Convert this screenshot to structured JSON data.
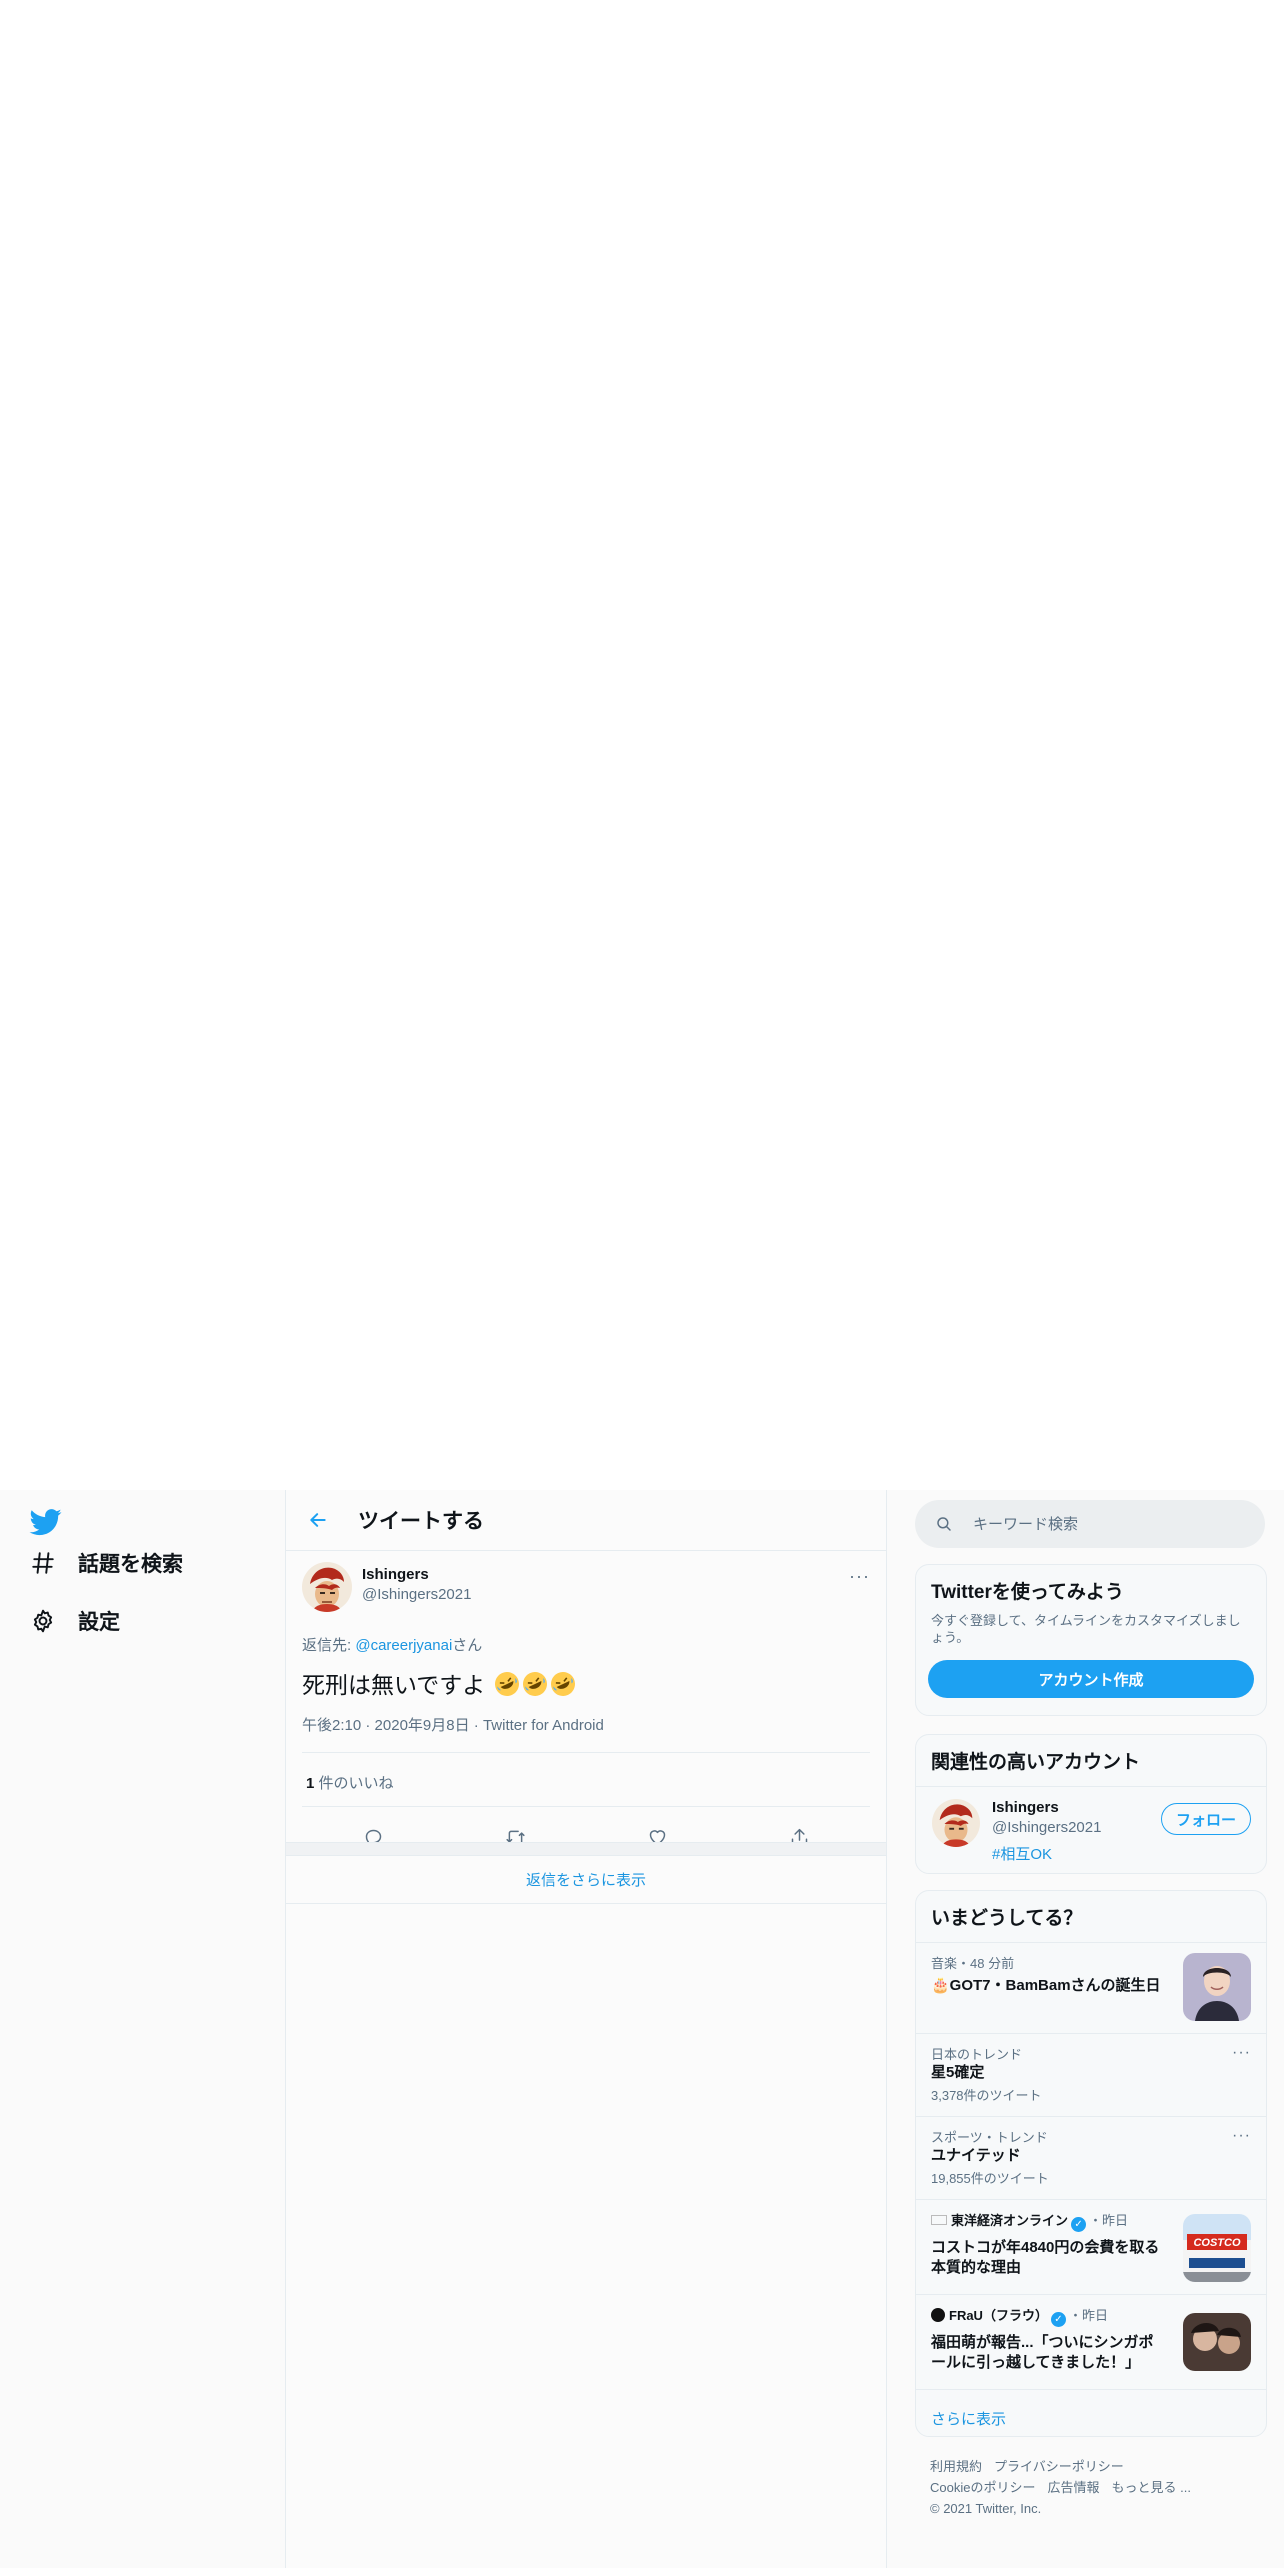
{
  "nav": {
    "explore_label": "話題を検索",
    "settings_label": "設定"
  },
  "header": {
    "title": "ツイートする"
  },
  "tweet": {
    "author_name": "Ishingers",
    "author_handle": "@Ishingers2021",
    "more_label": "···",
    "reply_prefix": "返信先: ",
    "reply_to": "@careerjyanai",
    "reply_suffix": "さん",
    "text": "死刑は無いですよ",
    "time": "午後2:10",
    "date": "2020年9月8日",
    "source": "Twitter for Android",
    "like_count": "1",
    "like_label": " 件のいいね"
  },
  "replies": {
    "show_more_label": "返信をさらに表示"
  },
  "search": {
    "placeholder": "キーワード検索"
  },
  "signup": {
    "title": "Twitterを使ってみよう",
    "desc": "今すぐ登録して、タイムラインをカスタマイズしましょう。",
    "button": "アカウント作成"
  },
  "related": {
    "title": "関連性の高いアカウント",
    "name": "Ishingers",
    "handle": "@Ishingers2021",
    "hashtag": "#相互OK",
    "follow_label": "フォロー"
  },
  "trends": {
    "title": "いまどうしてる？",
    "items": [
      {
        "meta": "音楽・48 分前",
        "title": "🎂GOT7・BamBamさんの誕生日"
      },
      {
        "meta": "日本のトレンド",
        "title": "星5確定",
        "count": "3,378件のツイート"
      },
      {
        "meta": "スポーツ・トレンド",
        "title": "ユナイテッド",
        "count": "19,855件のツイート"
      },
      {
        "source": "東洋経済オンライン",
        "time": "・昨日",
        "title": "コストコが年4840円の会費を取る本質的な理由"
      },
      {
        "source": "FRaU（フラウ）",
        "time": "・昨日",
        "title": "福田萌が報告...「ついにシンガポールに引っ越してきました！」"
      }
    ],
    "show_more_label": "さらに表示"
  },
  "footer": {
    "links": [
      "利用規約",
      "プライバシーポリシー",
      "Cookieのポリシー",
      "広告情報",
      "もっと見る ..."
    ],
    "copyright": "© 2021 Twitter, Inc."
  },
  "colors": {
    "accent": "#1da1f2",
    "link": "#1b95e0",
    "muted": "#5b7083"
  }
}
